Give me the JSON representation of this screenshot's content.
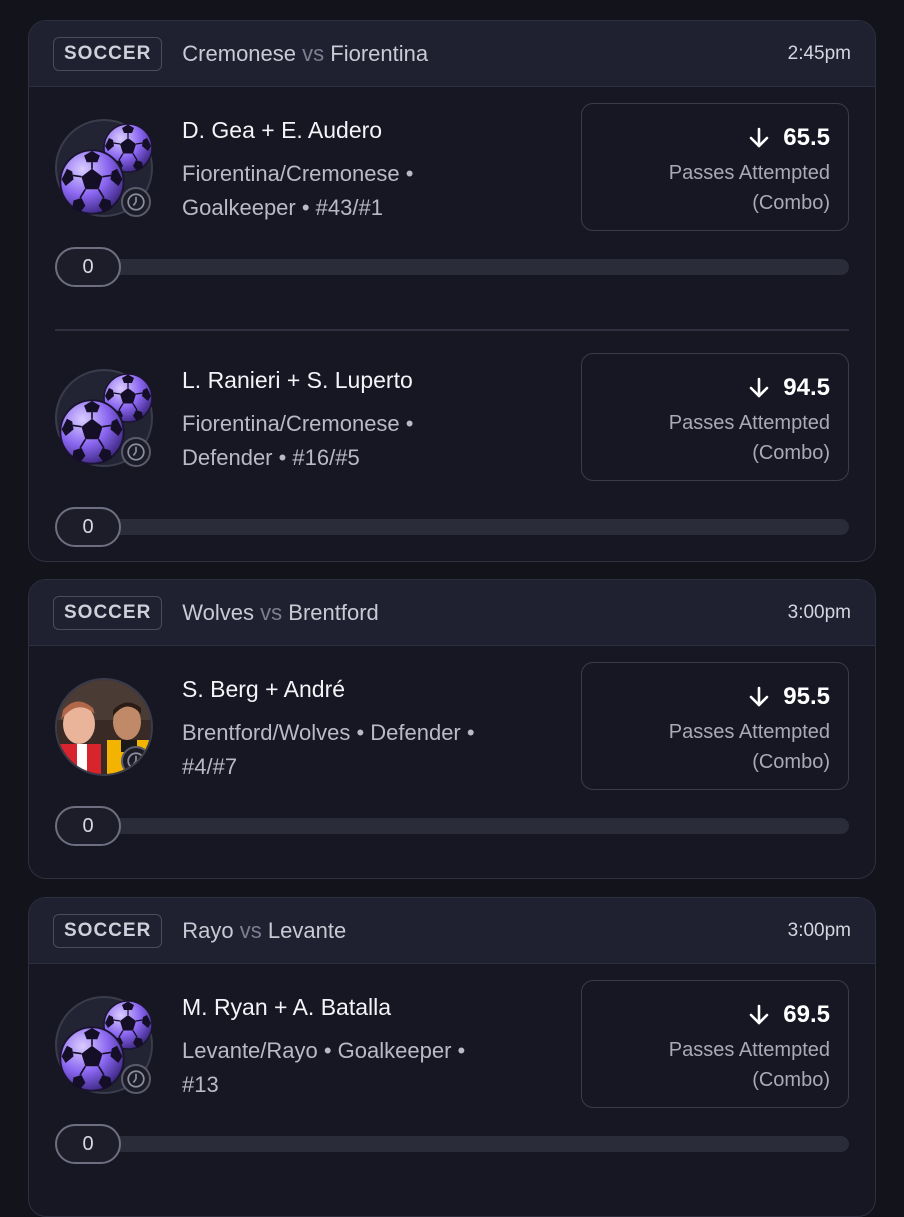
{
  "games": [
    {
      "sport": "SOCCER",
      "team_a": "Cremonese",
      "vs": "vs",
      "team_b": "Fiorentina",
      "time": "2:45pm",
      "picks": [
        {
          "name": "D. Gea + E. Audero",
          "info_line1": "Fiorentina/Cremonese •",
          "info_line2": "Goalkeeper • #43/#1",
          "line": "65.5",
          "direction": "down-arrow-icon",
          "stat_line1": "Passes Attempted",
          "stat_line2": "(Combo)",
          "progress": "0",
          "avatar": "soccer-ball-icon"
        },
        {
          "name": "L. Ranieri + S. Luperto",
          "info_line1": "Fiorentina/Cremonese •",
          "info_line2": "Defender • #16/#5",
          "line": "94.5",
          "direction": "down-arrow-icon",
          "stat_line1": "Passes Attempted",
          "stat_line2": "(Combo)",
          "progress": "0",
          "avatar": "soccer-ball-icon"
        }
      ]
    },
    {
      "sport": "SOCCER",
      "team_a": "Wolves",
      "vs": "vs",
      "team_b": "Brentford",
      "time": "3:00pm",
      "picks": [
        {
          "name": "S. Berg + André",
          "info_line1": "Brentford/Wolves • Defender •",
          "info_line2": "#4/#7",
          "line": "95.5",
          "direction": "down-arrow-icon",
          "stat_line1": "Passes Attempted",
          "stat_line2": "(Combo)",
          "progress": "0",
          "avatar": "player-photo"
        }
      ]
    },
    {
      "sport": "SOCCER",
      "team_a": "Rayo",
      "vs": "vs",
      "team_b": "Levante",
      "time": "3:00pm",
      "picks": [
        {
          "name": "M. Ryan + A. Batalla",
          "info_line1": "Levante/Rayo • Goalkeeper •",
          "info_line2": "#13",
          "line": "69.5",
          "direction": "down-arrow-icon",
          "stat_line1": "Passes Attempted",
          "stat_line2": "(Combo)",
          "progress": "0",
          "avatar": "soccer-ball-icon"
        }
      ]
    }
  ]
}
